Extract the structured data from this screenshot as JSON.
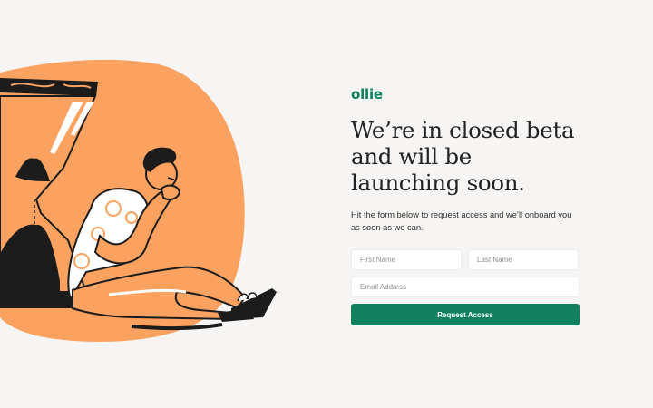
{
  "brand": {
    "logo": "ollie",
    "accent": "#11805f",
    "illustration_color": "#fba260"
  },
  "hero": {
    "headline": "We’re in closed beta and will be launching soon.",
    "subtext": "Hit the form below to request access and we’ll onboard you as soon as we can."
  },
  "form": {
    "first_name_placeholder": "First Name",
    "last_name_placeholder": "Last Name",
    "email_placeholder": "Email Address",
    "first_name_value": "",
    "last_name_value": "",
    "email_value": "",
    "submit_label": "Request Access"
  }
}
